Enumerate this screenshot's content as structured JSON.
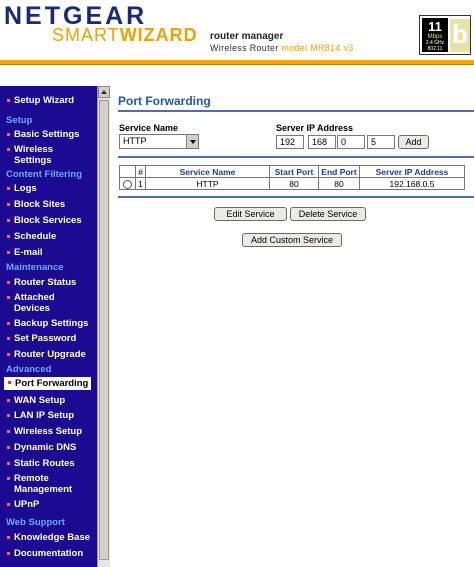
{
  "header": {
    "logo_top": "NETGEAR",
    "logo_bottom_a": "SMART",
    "logo_bottom_b": "WIZARD",
    "title": "router manager",
    "subtitle_prefix": "Wireless Router ",
    "subtitle_model": "model MR814 v3",
    "badge_speed": "11",
    "badge_unit": "Mbps",
    "badge_freq": "2.4 GHz",
    "badge_std": "802.11",
    "badge_letter": "b"
  },
  "sidebar": {
    "setup_wizard": "Setup Wizard",
    "setup": "Setup",
    "basic_settings": "Basic Settings",
    "wireless_settings_1": "Wireless",
    "wireless_settings_2": "Settings",
    "content_filtering": "Content Filtering",
    "logs": "Logs",
    "block_sites": "Block Sites",
    "block_services": "Block Services",
    "schedule": "Schedule",
    "email": "E-mail",
    "maintenance": "Maintenance",
    "router_status": "Router Status",
    "attached_1": "Attached",
    "attached_2": "Devices",
    "backup_settings": "Backup Settings",
    "set_password": "Set Password",
    "router_upgrade": "Router Upgrade",
    "advanced": "Advanced",
    "port_forwarding": "Port Forwarding",
    "wan_setup": "WAN Setup",
    "lan_ip_setup": "LAN IP Setup",
    "wireless_setup": "Wireless Setup",
    "dynamic_dns": "Dynamic DNS",
    "static_routes": "Static Routes",
    "remote_1": "Remote",
    "remote_2": "Management",
    "upnp": "UPnP",
    "web_support": "Web Support",
    "knowledge_base": "Knowledge Base",
    "documentation": "Documentation"
  },
  "main": {
    "page_title": "Port Forwarding",
    "service_name_label": "Service Name",
    "service_name_value": "HTTP",
    "server_ip_label": "Server IP Address",
    "ip": [
      "192",
      "168",
      "0",
      "5"
    ],
    "add_button": "Add",
    "table": {
      "headers": [
        "#",
        "Service Name",
        "Start Port",
        "End Port",
        "Server IP Address"
      ],
      "rows": [
        {
          "index": "1",
          "service": "HTTP",
          "start": "80",
          "end": "80",
          "ip": "192.168.0.5"
        }
      ]
    },
    "edit_service": "Edit Service",
    "delete_service": "Delete Service",
    "add_custom_service": "Add Custom Service"
  },
  "colors": {
    "sidebar_bg": "#1b0b93",
    "section_header": "#6da8ff",
    "title_blue": "#1e56b0",
    "accent_orange": "#f5a600"
  }
}
